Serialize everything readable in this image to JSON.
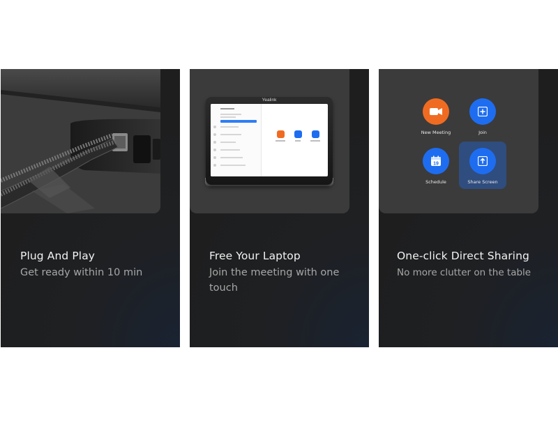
{
  "cards": [
    {
      "title": "Plug And Play",
      "subtitle": "Get ready within 10 min"
    },
    {
      "title": "Free Your Laptop",
      "subtitle": "Join the meeting with one touch",
      "device": {
        "brand": "Yealink"
      }
    },
    {
      "title": "One-click Direct Sharing",
      "subtitle": "No more clutter on the table",
      "apps": [
        {
          "label": "New Meeting",
          "icon": "video-camera-icon",
          "color": "#f06b22"
        },
        {
          "label": "Join",
          "icon": "plus-icon",
          "color": "#1e6df0"
        },
        {
          "label": "Schedule",
          "icon": "calendar-icon",
          "color": "#1e6df0",
          "date": "19"
        },
        {
          "label": "Share Screen",
          "icon": "share-up-arrow-icon",
          "color": "#1e6df0"
        }
      ]
    }
  ]
}
